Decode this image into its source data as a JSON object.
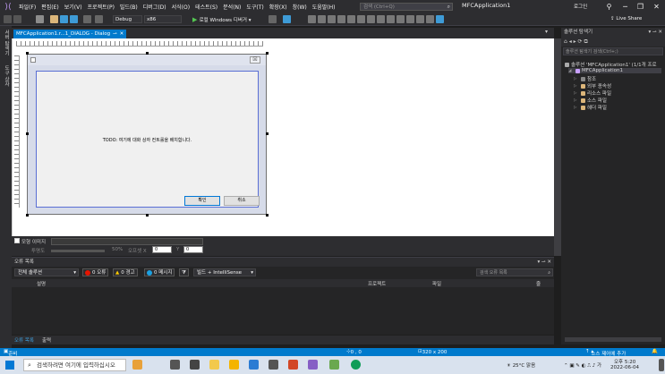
{
  "app": {
    "title": "MFCApplication1",
    "login": "로그인"
  },
  "menu": [
    "파일(F)",
    "편집(E)",
    "보기(V)",
    "프로젝트(P)",
    "빌드(B)",
    "디버그(D)",
    "서식(O)",
    "테스트(S)",
    "분석(N)",
    "도구(T)",
    "확장(X)",
    "창(W)",
    "도움말(H)"
  ],
  "search": {
    "placeholder": "검색 (Ctrl+Q)"
  },
  "toolbar": {
    "config": "Debug",
    "platform": "x86",
    "run_label": "로컬 Windows 디버거",
    "liveshare": "Live Share"
  },
  "left_strip": {
    "items": [
      "서버 탐색기",
      "도구 상자"
    ]
  },
  "editor": {
    "tab_label": "MFCApplication1.r...1_DIALOG - Dialog",
    "dialog": {
      "todo_text": "TODO: 여기에 대화 상자 컨트롤을 배치합니다.",
      "ok_label": "확인",
      "cancel_label": "취소",
      "close_glyph": "☒"
    }
  },
  "editor_bottom": {
    "checkbox_label": "모형 이미지",
    "transparency_label": "투명도",
    "transparency_value": "50%",
    "offset_x_label": "오프셋 X",
    "offset_x_value": "0",
    "offset_y_label": "Y",
    "offset_y_value": "0"
  },
  "solution_explorer": {
    "title": "솔루션 탐색기",
    "search_placeholder": "솔루션 탐색기 검색(Ctrl+;)",
    "items": [
      {
        "label": "솔루션 'MFCApplication1' (1/1개 프로",
        "level": 0
      },
      {
        "label": "MFCApplication1",
        "level": 1
      },
      {
        "label": "참조",
        "level": 2
      },
      {
        "label": "외부 종속성",
        "level": 2
      },
      {
        "label": "리소스 파일",
        "level": 2
      },
      {
        "label": "소스 파일",
        "level": 2
      },
      {
        "label": "헤더 파일",
        "level": 2
      }
    ]
  },
  "error_list": {
    "title": "오류 목록",
    "scope": "전체 솔루션",
    "errors": "0 오류",
    "warnings": "0 경고",
    "messages": "0 메시지",
    "build_filter": "빌드 + IntelliSense",
    "search_placeholder": "검색 오류 목록",
    "columns": [
      "설명",
      "프로젝트",
      "파일",
      "줄"
    ]
  },
  "bottom_tabs": [
    "오류 목록",
    "출력"
  ],
  "status": {
    "ready": "준비",
    "cursor": "0 , 0",
    "size": "320 x 200",
    "source_control": "소스 제어에 추가"
  },
  "taskbar": {
    "search_placeholder": "검색하려면 여기에 입력하십시오",
    "weather": "25°C 맑음",
    "time_label": "오후 5:20",
    "date": "2022-06-04"
  },
  "colors": {
    "accent": "#007acc",
    "vs_purple": "#c9a0ff",
    "dialog_border": "#5a6fd4"
  }
}
